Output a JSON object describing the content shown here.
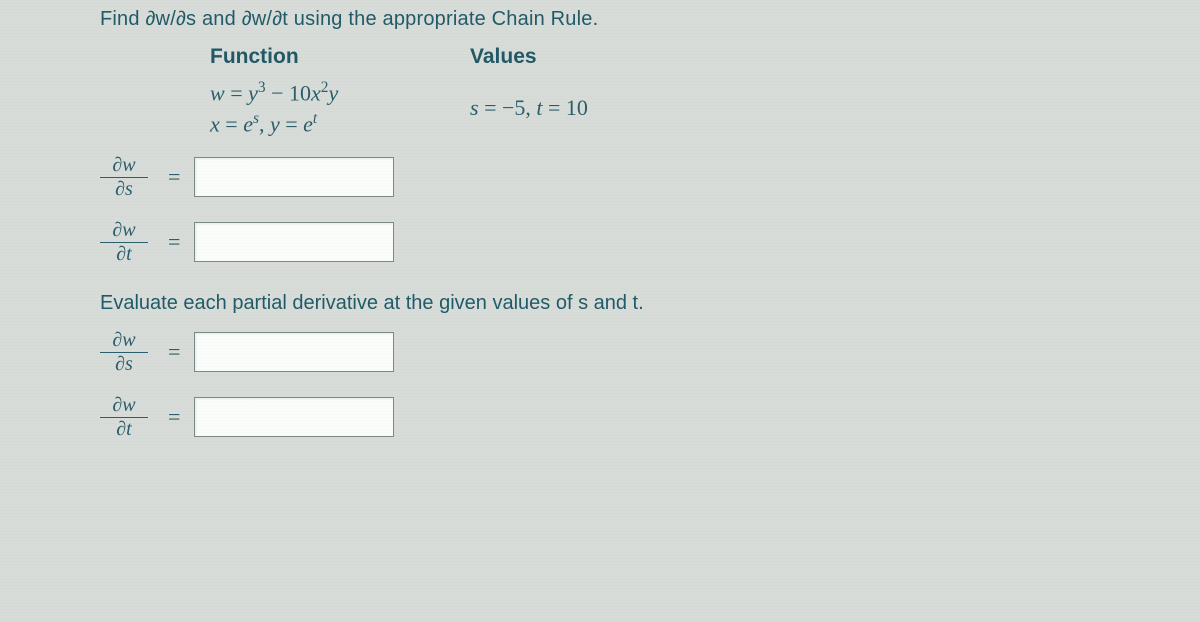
{
  "prompt_line1": "Find ∂w/∂s and ∂w/∂t using the appropriate Chain Rule.",
  "headers": {
    "function": "Function",
    "values": "Values"
  },
  "function": {
    "line1_parts": {
      "w": "w",
      "eq": " = ",
      "y": "y",
      "exp3": "3",
      "minus": " − 10",
      "x": "x",
      "exp2": "2",
      "y2": "y"
    },
    "line2_parts": {
      "x": "x",
      "eq1": " = ",
      "e1": "e",
      "s": "s",
      "comma": ",  ",
      "y": "y",
      "eq2": " = ",
      "e2": "e",
      "t": "t"
    }
  },
  "values_parts": {
    "s": "s",
    "eq1": " = −5,  ",
    "t": "t",
    "eq2": " = 10"
  },
  "derivs": {
    "dw": "∂w",
    "ds": "∂s",
    "dt": "∂t",
    "equals": "="
  },
  "eval_prompt": "Evaluate each partial derivative at the given values of s and t.",
  "answers": {
    "dwds1": "",
    "dwdt1": "",
    "dwds2": "",
    "dwdt2": ""
  }
}
